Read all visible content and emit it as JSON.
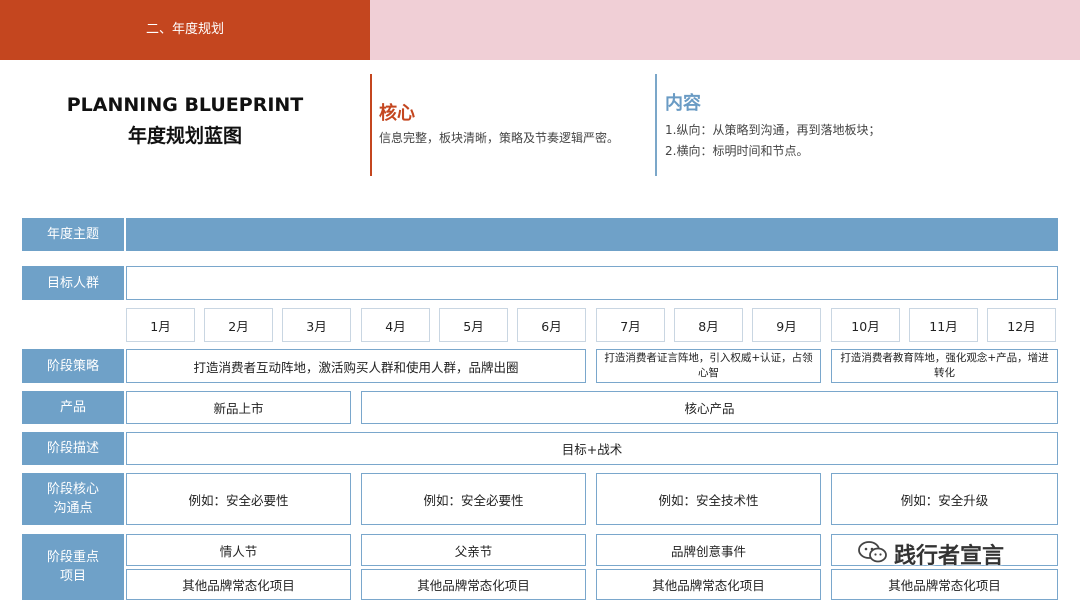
{
  "header": {
    "section_title": "二、年度规划"
  },
  "blueprint": {
    "title_en": "PLANNING BLUEPRINT",
    "title_cn": "年度规划蓝图"
  },
  "core": {
    "heading": "核心",
    "text": "信息完整，板块清晰，策略及节奏逻辑严密。"
  },
  "content": {
    "heading": "内容",
    "line1": "1.纵向：从策略到沟通，再到落地板块；",
    "line2": "2.横向：标明时间和节点。"
  },
  "rows": {
    "theme": "年度主题",
    "audience": "目标人群",
    "strategy": "阶段策略",
    "product": "产品",
    "description": "阶段描述",
    "comm_line1": "阶段核心",
    "comm_line2": "沟通点",
    "key_line1": "阶段重点",
    "key_line2": "项目"
  },
  "months": [
    "1月",
    "2月",
    "3月",
    "4月",
    "5月",
    "6月",
    "7月",
    "8月",
    "9月",
    "10月",
    "11月",
    "12月"
  ],
  "strategy_cells": [
    "打造消费者互动阵地，激活购买人群和使用人群，品牌出圈",
    "打造消费者证言阵地，引入权威+认证，占领心智",
    "打造消费者教育阵地，强化观念+产品，增进转化"
  ],
  "product_cells": [
    "新品上市",
    "核心产品"
  ],
  "description_cell": "目标+战术",
  "comm_cells": [
    "例如：安全必要性",
    "例如：安全必要性",
    "例如：安全技术性",
    "例如：安全升级"
  ],
  "key_top_cells": [
    "情人节",
    "父亲节",
    "品牌创意事件",
    ""
  ],
  "key_bottom_cells": [
    "其他品牌常态化项目",
    "其他品牌常态化项目",
    "其他品牌常态化项目",
    "其他品牌常态化项目"
  ],
  "watermark": {
    "icon": "wechat-icon",
    "text": "践行者宣言"
  }
}
